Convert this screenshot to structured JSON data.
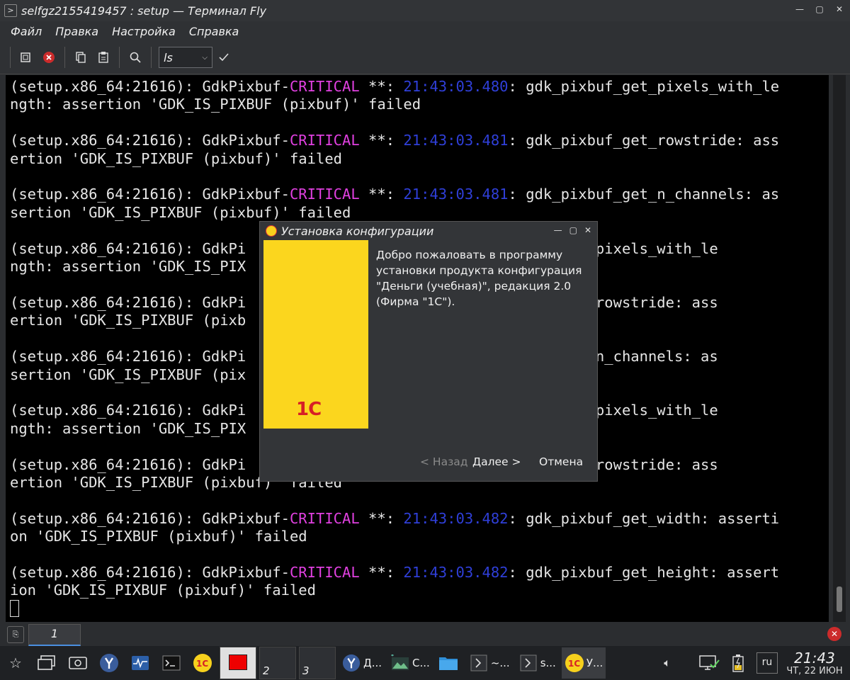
{
  "window": {
    "title": "selfgz2155419457 : setup — Терминал Fly",
    "controls": [
      "—",
      "▢",
      "✕"
    ]
  },
  "menu": [
    "Файл",
    "Правка",
    "Настройка",
    "Справка"
  ],
  "toolbar": {
    "command_value": "ls"
  },
  "terminal": {
    "lines": [
      [
        {
          "t": "(setup.x86_64:21616): GdkPixbuf-"
        },
        {
          "t": "CRITICAL",
          "c": "crit"
        },
        {
          "t": " **: "
        },
        {
          "t": "21:43:03.480",
          "c": "time"
        },
        {
          "t": ": gdk_pixbuf_get_pixels_with_le"
        }
      ],
      [
        {
          "t": "ngth: assertion 'GDK_IS_PIXBUF (pixbuf)' failed"
        }
      ],
      [
        {
          "t": ""
        }
      ],
      [
        {
          "t": "(setup.x86_64:21616): GdkPixbuf-"
        },
        {
          "t": "CRITICAL",
          "c": "crit"
        },
        {
          "t": " **: "
        },
        {
          "t": "21:43:03.481",
          "c": "time"
        },
        {
          "t": ": gdk_pixbuf_get_rowstride: ass"
        }
      ],
      [
        {
          "t": "ertion 'GDK_IS_PIXBUF (pixbuf)' failed"
        }
      ],
      [
        {
          "t": ""
        }
      ],
      [
        {
          "t": "(setup.x86_64:21616): GdkPixbuf-"
        },
        {
          "t": "CRITICAL",
          "c": "crit"
        },
        {
          "t": " **: "
        },
        {
          "t": "21:43:03.481",
          "c": "time"
        },
        {
          "t": ": gdk_pixbuf_get_n_channels: as"
        }
      ],
      [
        {
          "t": "sertion 'GDK_IS_PIXBUF (pixbuf)' failed"
        }
      ],
      [
        {
          "t": ""
        }
      ],
      [
        {
          "t": "(setup.x86_64:21616): GdkPi                             pixbuf_get_pixels_with_le"
        }
      ],
      [
        {
          "t": "ngth: assertion 'GDK_IS_PIX"
        }
      ],
      [
        {
          "t": ""
        }
      ],
      [
        {
          "t": "(setup.x86_64:21616): GdkPi                             pixbuf_get_rowstride: ass"
        }
      ],
      [
        {
          "t": "ertion 'GDK_IS_PIXBUF (pixb"
        }
      ],
      [
        {
          "t": ""
        }
      ],
      [
        {
          "t": "(setup.x86_64:21616): GdkPi                             pixbuf_get_n_channels: as"
        }
      ],
      [
        {
          "t": "sertion 'GDK_IS_PIXBUF (pix"
        }
      ],
      [
        {
          "t": ""
        }
      ],
      [
        {
          "t": "(setup.x86_64:21616): GdkPi                             pixbuf_get_pixels_with_le"
        }
      ],
      [
        {
          "t": "ngth: assertion 'GDK_IS_PIX"
        }
      ],
      [
        {
          "t": ""
        }
      ],
      [
        {
          "t": "(setup.x86_64:21616): GdkPi                             pixbuf_get_rowstride: ass"
        }
      ],
      [
        {
          "t": "ertion 'GDK_IS_PIXBUF (pixbuf)' failed"
        }
      ],
      [
        {
          "t": ""
        }
      ],
      [
        {
          "t": "(setup.x86_64:21616): GdkPixbuf-"
        },
        {
          "t": "CRITICAL",
          "c": "crit"
        },
        {
          "t": " **: "
        },
        {
          "t": "21:43:03.482",
          "c": "time"
        },
        {
          "t": ": gdk_pixbuf_get_width: asserti"
        }
      ],
      [
        {
          "t": "on 'GDK_IS_PIXBUF (pixbuf)' failed"
        }
      ],
      [
        {
          "t": ""
        }
      ],
      [
        {
          "t": "(setup.x86_64:21616): GdkPixbuf-"
        },
        {
          "t": "CRITICAL",
          "c": "crit"
        },
        {
          "t": " **: "
        },
        {
          "t": "21:43:03.482",
          "c": "time"
        },
        {
          "t": ": gdk_pixbuf_get_height: assert"
        }
      ],
      [
        {
          "t": "ion 'GDK_IS_PIXBUF (pixbuf)' failed"
        }
      ]
    ]
  },
  "tabs": [
    {
      "label": "1"
    }
  ],
  "dialog": {
    "title": "Установка конфигурации",
    "logo": "1С",
    "welcome_text": "Добро пожаловать в программу установки продукта конфигурация \"Деньги (учебная)\", редакция 2.0 (Фирма \"1С\").",
    "back_label": "< Назад",
    "next_label": "Далее >",
    "cancel_label": "Отмена"
  },
  "taskbar": {
    "desktops": [
      "1",
      "2",
      "3"
    ],
    "tasks": [
      {
        "label": "Д...",
        "icon": "yandex-browser-icon"
      },
      {
        "label": "С...",
        "icon": "image-viewer-icon"
      },
      {
        "label": "",
        "icon": "folder-icon"
      },
      {
        "label": "~...",
        "icon": "terminal-icon"
      },
      {
        "label": "s...",
        "icon": "terminal-icon"
      },
      {
        "label": "У...",
        "icon": "1c-icon"
      }
    ],
    "lang": "ru",
    "time": "21:43",
    "date": "ЧТ, 22 ИЮН"
  },
  "colors": {
    "critical": "#e040e0",
    "timestamp": "#2f3fd8",
    "banner": "#fbd61e",
    "logo": "#d61f26"
  }
}
